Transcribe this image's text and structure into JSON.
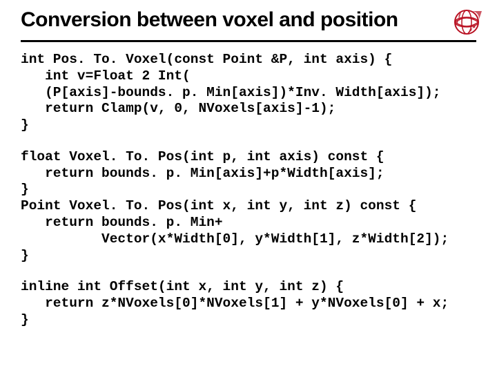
{
  "slide": {
    "title": "Conversion between voxel and position",
    "logo_alt": "red-globe-logo"
  },
  "code": {
    "block1": "int Pos. To. Voxel(const Point &P, int axis) {\n   int v=Float 2 Int(\n   (P[axis]-bounds. p. Min[axis])*Inv. Width[axis]);\n   return Clamp(v, 0, NVoxels[axis]-1);\n}",
    "block2": "float Voxel. To. Pos(int p, int axis) const {\n   return bounds. p. Min[axis]+p*Width[axis];\n}\nPoint Voxel. To. Pos(int x, int y, int z) const {\n   return bounds. p. Min+\n          Vector(x*Width[0], y*Width[1], z*Width[2]);\n}",
    "block3": "inline int Offset(int x, int y, int z) {\n   return z*NVoxels[0]*NVoxels[1] + y*NVoxels[0] + x;\n}"
  }
}
